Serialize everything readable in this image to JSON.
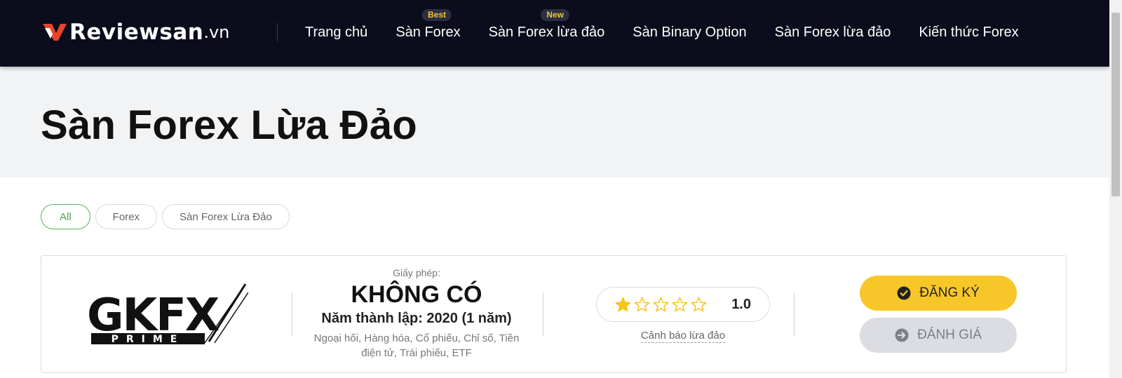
{
  "header": {
    "logo_main": "Reviewsan",
    "logo_tld": ".vn",
    "nav": [
      {
        "label": "Trang chủ",
        "badge": ""
      },
      {
        "label": "Sàn Forex",
        "badge": "Best"
      },
      {
        "label": "Sàn Forex lừa đảo",
        "badge": "New"
      },
      {
        "label": "Sàn Binary Option",
        "badge": ""
      },
      {
        "label": "Sàn Forex lừa đảo",
        "badge": ""
      },
      {
        "label": "Kiến thức Forex",
        "badge": ""
      }
    ]
  },
  "hero": {
    "title": "Sàn Forex Lừa Đảo"
  },
  "filters": [
    "All",
    "Forex",
    "Sàn Forex Lừa Đảo"
  ],
  "broker": {
    "logo_text": "GKFX",
    "logo_subtext": "PRIME",
    "license_label": "Giấy phép:",
    "license_value": "KHÔNG CÓ",
    "founded": "Năm thành lập: 2020 (1 năm)",
    "products": "Ngoại hối, Hàng hóa, Cổ phiếu, Chỉ số, Tiền điện tử, Trái phiếu, ETF",
    "rating": 1,
    "rating_max": 5,
    "rating_label": "1.0",
    "warning_link": "Cảnh báo lừa đảo",
    "register_label": "ĐĂNG KÝ",
    "review_label": "ĐÁNH GIÁ"
  },
  "colors": {
    "header_bg": "#0b0d1c",
    "accent_yellow": "#f7c72a",
    "badge_text": "#f6c623",
    "active_chip": "#4aa84a",
    "logo_mark": "#e8452c",
    "star": "#f5c518"
  },
  "icons": {
    "register": "check-circle-icon",
    "review": "arrow-right-circle-icon"
  }
}
